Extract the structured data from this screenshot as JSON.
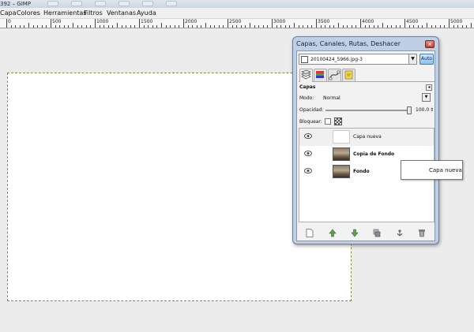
{
  "window": {
    "title": "392 – GIMP"
  },
  "menubar": {
    "items": [
      "Capa",
      "Colores",
      "Herramientas",
      "Filtros",
      "Ventanas",
      "Ayuda"
    ]
  },
  "ruler": {
    "labels": [
      "0",
      "500",
      "1000",
      "1500",
      "2000",
      "2500",
      "3000",
      "3500",
      "4000",
      "4500",
      "5000"
    ]
  },
  "dock": {
    "title": "Capas, Canales, Rutas, Deshacer",
    "close_glyph": "×",
    "image_selector": "20100424_5966.jpg-3",
    "auto_label": "Auto",
    "section_title": "Capas",
    "mode_label": "Modo:",
    "mode_value": "Normal",
    "opacity_label": "Opacidad:",
    "opacity_value": "100.0",
    "lock_label": "Bloquear:",
    "layers": [
      {
        "name": "Capa nueva",
        "bold": false,
        "thumb": "blank"
      },
      {
        "name": "Copia de Fondo",
        "bold": true,
        "thumb": "photo"
      },
      {
        "name": "Fondo",
        "bold": true,
        "thumb": "photo"
      }
    ]
  },
  "tooltip": {
    "text": "Capa nueva"
  }
}
